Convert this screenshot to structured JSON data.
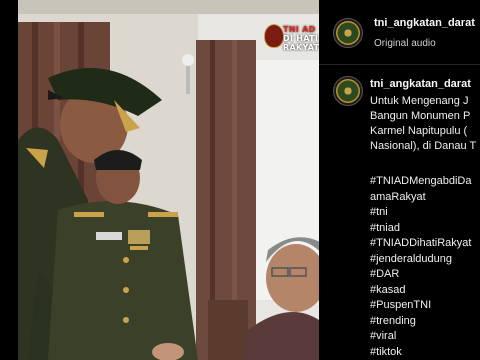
{
  "watermark": {
    "line1": "TNI AD",
    "line2": "DI HATI",
    "line3": "RAKYAT"
  },
  "post": {
    "username": "tni_angkatan_darat",
    "audio": "Original audio"
  },
  "comment": {
    "username": "tni_angkatan_darat",
    "caption_lines": [
      "Untuk Mengenang J",
      "Bangun Monumen P",
      "Karmel Napitupulu (",
      "Nasional), di Danau T"
    ],
    "hashtags": [
      "#TNIADMengabdiDa",
      "amaRakyat",
      "#tni",
      "#tniad",
      "#TNIADDihatiRakyat",
      "#jenderaldudung",
      "#DAR",
      "#kasad",
      "#PuspenTNI",
      "#trending",
      "#viral",
      "#tiktok"
    ]
  }
}
